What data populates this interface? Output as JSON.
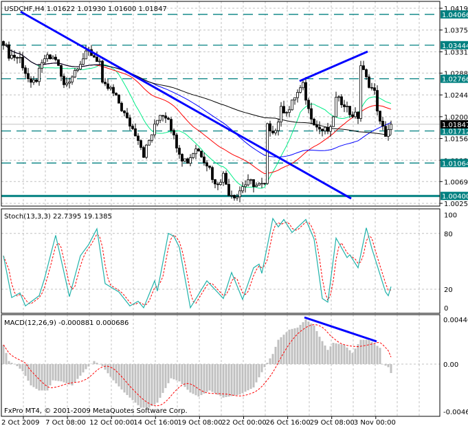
{
  "header": {
    "symbol_label": "USDCHF,H4",
    "open": "1.01622",
    "high": "1.01930",
    "low": "1.01600",
    "close": "1.01847"
  },
  "stoch_panel": {
    "label": "Stoch(13,3,3) 22.7395 19.1385",
    "axis_labels": [
      "100",
      "80",
      "20",
      "0"
    ]
  },
  "macd_panel": {
    "label": "MACD(12,26,9) -0.000881 0.000686",
    "axis_labels": [
      "0.00440",
      "0.00",
      "-0.00466"
    ]
  },
  "copyright": "FxPro MT4, © 2001-2009 MetaQuotes Software Corp.",
  "colors": {
    "level": "#008080",
    "trendline": "#0000ff",
    "ma_fast": "#00ee88",
    "ma_mid": "#ff0000",
    "ma_slow": "#0000ff",
    "ma_long": "#000000",
    "stoch_main": "#20b2aa",
    "signal": "#ff0000",
    "histogram": "#c0c0c0"
  },
  "chart_data": {
    "type": "candlestick",
    "symbol": "USDCHF",
    "timeframe": "H4",
    "price_axis_labels": [
      "1.04190",
      "1.03750",
      "1.03310",
      "1.02880",
      "1.02440",
      "1.02000",
      "1.01560",
      "1.01120",
      "1.00690",
      "1.00250"
    ],
    "ylim": [
      1.0025,
      1.0419
    ],
    "levels": [
      "1.04066",
      "1.03444",
      "1.02766",
      "1.01712",
      "1.01064",
      "1.00400"
    ],
    "current_price": "1.01847",
    "time_labels": [
      "2 Oct 2009",
      "7 Oct 08:00",
      "12 Oct 00:00",
      "14 Oct 16:00",
      "19 Oct 08:00",
      "22 Oct 00:00",
      "26 Oct 16:00",
      "29 Oct 08:00",
      "3 Nov 00:00"
    ],
    "bar_count": 142,
    "close_keypoints": [
      [
        0,
        1.0352
      ],
      [
        2,
        1.0325
      ],
      [
        6,
        1.0318
      ],
      [
        10,
        1.0262
      ],
      [
        12,
        1.0276
      ],
      [
        15,
        1.0318
      ],
      [
        19,
        1.0318
      ],
      [
        22,
        1.0262
      ],
      [
        25,
        1.0283
      ],
      [
        27,
        1.0304
      ],
      [
        31,
        1.0332
      ],
      [
        35,
        1.0311
      ],
      [
        36,
        1.0262
      ],
      [
        39,
        1.0255
      ],
      [
        42,
        1.0228
      ],
      [
        45,
        1.0193
      ],
      [
        49,
        1.0158
      ],
      [
        51,
        1.0124
      ],
      [
        54,
        1.0165
      ],
      [
        57,
        1.0207
      ],
      [
        60,
        1.02
      ],
      [
        62,
        1.0158
      ],
      [
        65,
        1.0117
      ],
      [
        67,
        1.011
      ],
      [
        70,
        1.0137
      ],
      [
        72,
        1.0124
      ],
      [
        75,
        1.0096
      ],
      [
        77,
        1.0061
      ],
      [
        80,
        1.0082
      ],
      [
        82,
        1.0047
      ],
      [
        85,
        1.004
      ],
      [
        87,
        1.0061
      ],
      [
        90,
        1.0068
      ],
      [
        92,
        1.0061
      ],
      [
        95,
        1.0061
      ],
      [
        96,
        1.0179
      ],
      [
        99,
        1.0172
      ],
      [
        101,
        1.0214
      ],
      [
        104,
        1.0214
      ],
      [
        106,
        1.0241
      ],
      [
        109,
        1.0262
      ],
      [
        111,
        1.0214
      ],
      [
        114,
        1.0179
      ],
      [
        116,
        1.0172
      ],
      [
        119,
        1.0172
      ],
      [
        121,
        1.0235
      ],
      [
        124,
        1.0228
      ],
      [
        126,
        1.0207
      ],
      [
        129,
        1.02
      ],
      [
        130,
        1.0304
      ],
      [
        132,
        1.0276
      ],
      [
        135,
        1.0248
      ],
      [
        137,
        1.0186
      ],
      [
        139,
        1.0165
      ],
      [
        141,
        1.01847
      ]
    ],
    "stoch": {
      "k_period": 13,
      "d_period": 3,
      "slowing": 3,
      "ylim": [
        0,
        100
      ],
      "levels": [
        80,
        20
      ],
      "main_keypoints": [
        [
          0,
          56
        ],
        [
          3,
          11
        ],
        [
          6,
          16
        ],
        [
          8,
          2
        ],
        [
          13,
          13
        ],
        [
          15,
          32
        ],
        [
          19,
          78
        ],
        [
          24,
          12
        ],
        [
          28,
          56
        ],
        [
          31,
          68
        ],
        [
          34,
          85
        ],
        [
          37,
          26
        ],
        [
          42,
          17
        ],
        [
          46,
          2
        ],
        [
          49,
          7
        ],
        [
          51,
          0
        ],
        [
          55,
          29
        ],
        [
          56,
          18
        ],
        [
          60,
          80
        ],
        [
          62,
          77
        ],
        [
          64,
          65
        ],
        [
          68,
          0
        ],
        [
          74,
          29
        ],
        [
          80,
          10
        ],
        [
          83,
          38
        ],
        [
          87,
          9
        ],
        [
          91,
          43
        ],
        [
          93,
          47
        ],
        [
          94,
          37
        ],
        [
          98,
          96
        ],
        [
          100,
          87
        ],
        [
          102,
          95
        ],
        [
          105,
          81
        ],
        [
          110,
          95
        ],
        [
          113,
          74
        ],
        [
          116,
          10
        ],
        [
          118,
          6
        ],
        [
          121,
          75
        ],
        [
          125,
          54
        ],
        [
          126,
          57
        ],
        [
          129,
          43
        ],
        [
          132,
          86
        ],
        [
          134,
          64
        ],
        [
          139,
          17
        ],
        [
          140,
          13
        ],
        [
          141,
          22.74
        ]
      ],
      "main_last": 22.7395,
      "signal_last": 19.1385
    },
    "macd": {
      "fast": 12,
      "slow": 26,
      "signal": 9,
      "ylim": [
        -0.00466,
        0.0044
      ],
      "histogram_keypoints": [
        [
          0,
          0.0019
        ],
        [
          2,
          0.0003
        ],
        [
          5,
          -0.0002
        ],
        [
          7,
          -0.0007
        ],
        [
          10,
          -0.0021
        ],
        [
          13,
          -0.0026
        ],
        [
          16,
          -0.0026
        ],
        [
          18,
          -0.0016
        ],
        [
          21,
          -0.0017
        ],
        [
          25,
          -0.0021
        ],
        [
          30,
          -0.0005
        ],
        [
          33,
          0.0003
        ],
        [
          36,
          -0.0002
        ],
        [
          40,
          -0.0016
        ],
        [
          44,
          -0.0028
        ],
        [
          50,
          -0.0043
        ],
        [
          53,
          -0.0043
        ],
        [
          56,
          -0.0038
        ],
        [
          61,
          -0.0014
        ],
        [
          64,
          -0.0017
        ],
        [
          68,
          -0.0028
        ],
        [
          71,
          -0.0032
        ],
        [
          75,
          -0.0026
        ],
        [
          80,
          -0.0033
        ],
        [
          86,
          -0.003
        ],
        [
          91,
          -0.0023
        ],
        [
          95,
          -0.0003
        ],
        [
          98,
          0.001
        ],
        [
          100,
          0.0024
        ],
        [
          104,
          0.0034
        ],
        [
          107,
          0.0036
        ],
        [
          110,
          0.0044
        ],
        [
          113,
          0.0038
        ],
        [
          115,
          0.0027
        ],
        [
          118,
          0.0014
        ],
        [
          120,
          0.0021
        ],
        [
          124,
          0.0019
        ],
        [
          127,
          0.0011
        ],
        [
          130,
          0.0024
        ],
        [
          133,
          0.0024
        ],
        [
          137,
          0.0016
        ],
        [
          138,
          0.0
        ],
        [
          140,
          -0.0003
        ],
        [
          141,
          -0.000881
        ]
      ],
      "main_last": -0.000881,
      "signal_last": 0.000686
    }
  }
}
